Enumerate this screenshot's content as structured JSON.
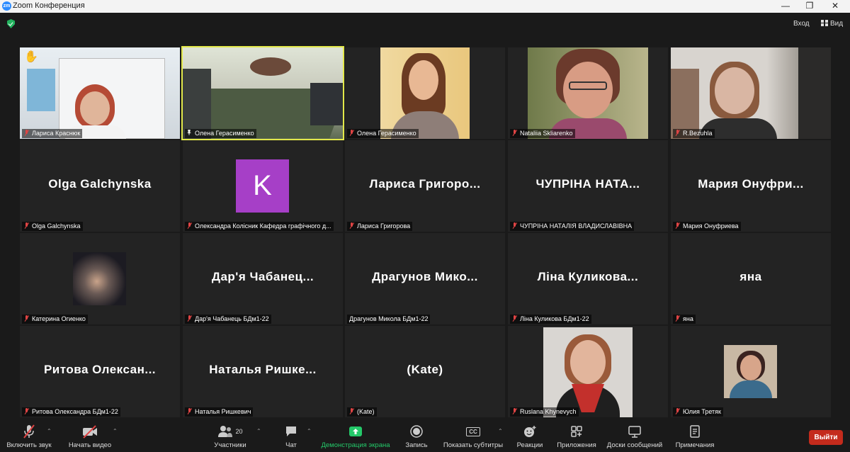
{
  "window": {
    "title": "Zoom Конференция",
    "logo": "zm"
  },
  "top": {
    "exit_label": "Вход",
    "view_label": "Вид"
  },
  "tiles": [
    {
      "name": "Лариса Краснюк",
      "big": "",
      "hand": "✋"
    },
    {
      "name": "Олена Герасименко",
      "big": "",
      "pinned": true
    },
    {
      "name": "Олена Герасименко",
      "big": ""
    },
    {
      "name": "Nataliia Skliarenko",
      "big": ""
    },
    {
      "name": "R.Bezuhla",
      "big": ""
    },
    {
      "name": "Olga Galchynska",
      "big": "Olga Galchynska"
    },
    {
      "name": "Олександра Колісник Кафедра графічного д...",
      "big": "",
      "avatar": "K"
    },
    {
      "name": "Лариса Григорова",
      "big": "Лариса  Григоро..."
    },
    {
      "name": "ЧУПРІНА НАТАЛІЯ ВЛАДИСЛАВІВНА",
      "big": "ЧУПРІНА  НАТА..."
    },
    {
      "name": "Мария Онуфриева",
      "big": "Мария  Онуфри..."
    },
    {
      "name": "Катерина Огиенко",
      "big": ""
    },
    {
      "name": "Дар'я Чабанець БДм1-22",
      "big": "Дар'я  Чабанец..."
    },
    {
      "name": "Драгунов Микола БДм1-22",
      "big": "Драгунов  Мико..."
    },
    {
      "name": "Ліна Куликова БДм1-22",
      "big": "Ліна  Куликова..."
    },
    {
      "name": "яна",
      "big": "яна"
    },
    {
      "name": "Ритова Олександра БДм1-22",
      "big": "Ритова  Олексан..."
    },
    {
      "name": "Наталья Ришкевич",
      "big": "Наталья  Ришке..."
    },
    {
      "name": "(Kate)",
      "big": "(Kate)"
    },
    {
      "name": "Ruslana Khynevych",
      "big": ""
    },
    {
      "name": "Юлия Третяк",
      "big": ""
    }
  ],
  "toolbar": {
    "audio": "Включить звук",
    "video": "Начать видео",
    "participants": "Участники",
    "participants_count": "20",
    "chat": "Чат",
    "share": "Демонстрация экрана",
    "record": "Запись",
    "captions": "Показать субтитры",
    "captions_icon": "CC",
    "reactions": "Реакции",
    "apps": "Приложения",
    "whiteboards": "Доски сообщений",
    "notes": "Примечания",
    "leave": "Выйти"
  },
  "colors": {
    "share_green": "#24c869",
    "leave_red": "#c42b1c",
    "active_border": "#e2e84a",
    "mute_red": "#e04444",
    "avatar_purple": "#a63fc7"
  }
}
